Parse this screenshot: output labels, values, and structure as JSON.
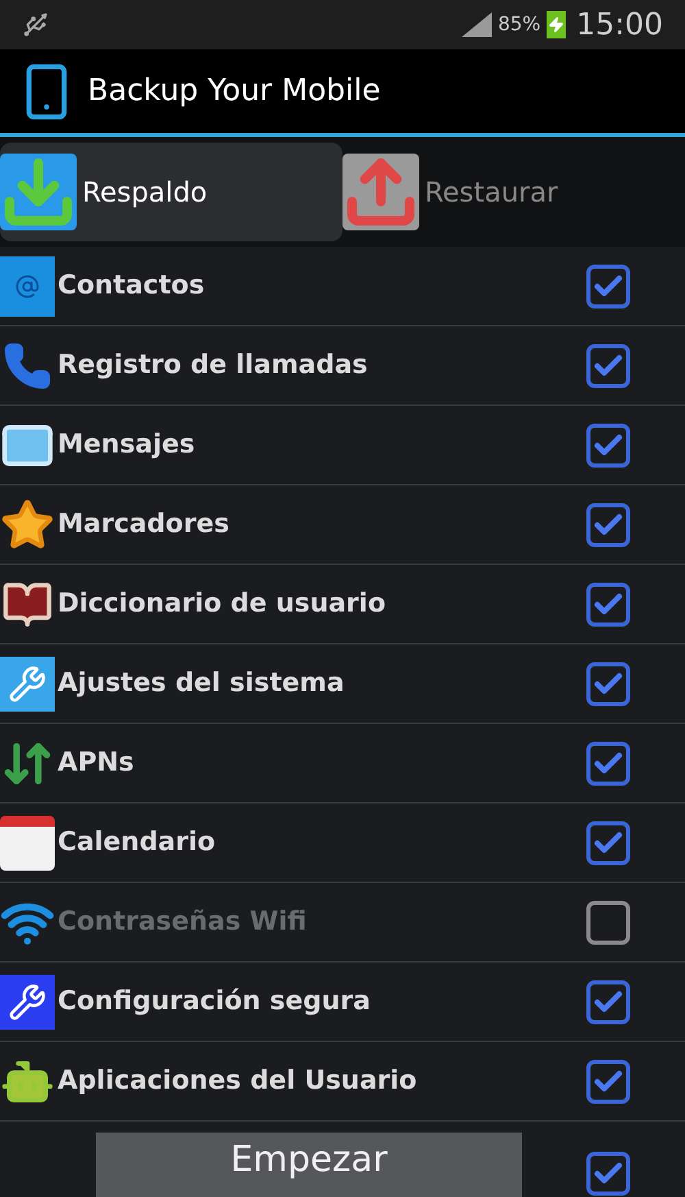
{
  "status_bar": {
    "battery": "85%",
    "time": "15:00"
  },
  "app_bar": {
    "title": "Backup Your Mobile"
  },
  "tabs": [
    {
      "label": "Respaldo",
      "selected": true
    },
    {
      "label": "Restaurar",
      "selected": false
    }
  ],
  "items": [
    {
      "label": "Contactos",
      "checked": true,
      "disabled": false
    },
    {
      "label": "Registro de llamadas",
      "checked": true,
      "disabled": false
    },
    {
      "label": "Mensajes",
      "checked": true,
      "disabled": false
    },
    {
      "label": "Marcadores",
      "checked": true,
      "disabled": false
    },
    {
      "label": "Diccionario de usuario",
      "checked": true,
      "disabled": false
    },
    {
      "label": "Ajustes del sistema",
      "checked": true,
      "disabled": false
    },
    {
      "label": "APNs",
      "checked": true,
      "disabled": false
    },
    {
      "label": "Calendario",
      "checked": true,
      "disabled": false
    },
    {
      "label": "Contraseñas Wifi",
      "checked": false,
      "disabled": true
    },
    {
      "label": "Configuración segura",
      "checked": true,
      "disabled": false
    },
    {
      "label": "Aplicaciones del Usuario",
      "checked": true,
      "disabled": false
    }
  ],
  "footer": {
    "button": "Empezar",
    "select_all": {
      "checked": true
    }
  }
}
